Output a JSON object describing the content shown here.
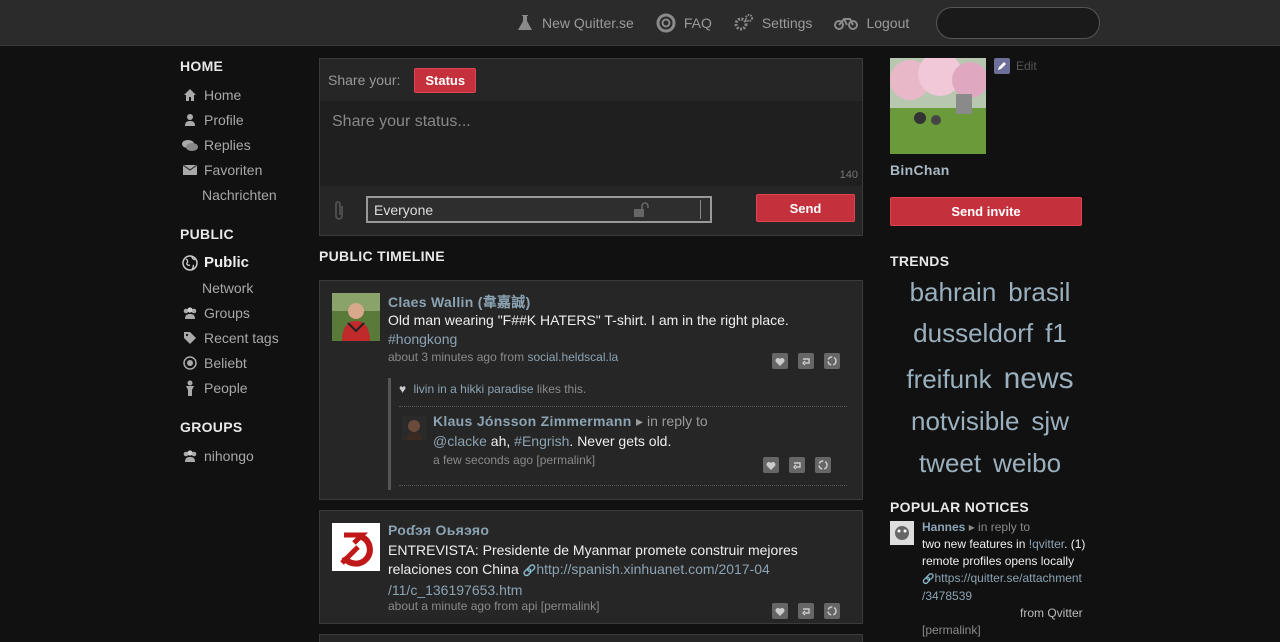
{
  "topnav": {
    "items": [
      {
        "label": "New Quitter.se",
        "icon": "flask-icon"
      },
      {
        "label": "FAQ",
        "icon": "lifebuoy-icon"
      },
      {
        "label": "Settings",
        "icon": "gears-icon"
      },
      {
        "label": "Logout",
        "icon": "bicycle-icon"
      }
    ]
  },
  "sidebar": {
    "home_heading": "HOME",
    "home_items": [
      {
        "label": "Home",
        "icon": "house-icon"
      },
      {
        "label": "Profile",
        "icon": "user-icon"
      },
      {
        "label": "Replies",
        "icon": "chat-icon"
      },
      {
        "label": "Favoriten",
        "icon": "mail-icon"
      },
      {
        "label": "Nachrichten",
        "icon": ""
      }
    ],
    "public_heading": "PUBLIC",
    "public_items": [
      {
        "label": "Public",
        "icon": "globe-icon"
      },
      {
        "label": "Network",
        "icon": ""
      },
      {
        "label": "Groups",
        "icon": "group-icon"
      },
      {
        "label": "Recent tags",
        "icon": "tag-icon"
      },
      {
        "label": "Beliebt",
        "icon": "target-icon"
      },
      {
        "label": "People",
        "icon": "person-icon"
      }
    ],
    "groups_heading": "GROUPS",
    "group_items": [
      {
        "label": "nihongo",
        "icon": "group-icon"
      }
    ]
  },
  "share": {
    "label": "Share your:",
    "type_button": "Status",
    "placeholder": "Share your status...",
    "char_count": "140",
    "scope_value": "Everyone",
    "send_label": "Send"
  },
  "timeline": {
    "title": "PUBLIC TIMELINE",
    "notices": [
      {
        "author": "Claes Wallin (韋嘉誠)",
        "text": "Old man wearing \"F##K HATERS\" T-shirt. I am in the right place.",
        "hashtag": "#hongkong",
        "time": "about 3 minutes ago",
        "from_word": "from",
        "source": "social.heldscal.la",
        "likes": {
          "who": "livin in a hikki paradise",
          "suffix": "likes this."
        },
        "reply": {
          "author": "Klaus Jónsson Zimmermann",
          "in_reply": "▸ in reply to",
          "mention": "@clacke",
          "mid": " ah, ",
          "tag": "#Engrish",
          "end": ". Never gets old.",
          "time": "a few seconds ago",
          "permalink": "[permalink]"
        }
      },
      {
        "author": "Роɗэя Оьяэяо",
        "text1": "ENTREVISTA: Presidente de Myanmar promete construir mejores",
        "text2": "relaciones con China",
        "link1": "http://spanish.xinhuanet.com/2017-04",
        "link2": "/11/c_136197653.htm",
        "time": "about a minute ago",
        "from_word": "from",
        "source": "api",
        "permalink": "[permalink]"
      }
    ]
  },
  "profile": {
    "edit": "Edit",
    "name": "BinChan",
    "invite": "Send invite"
  },
  "trends": {
    "heading": "TRENDS",
    "tags": [
      "bahrain",
      "brasil",
      "dusseldorf",
      "f1",
      "freifunk",
      "news",
      "notvisible",
      "sjw",
      "tweet",
      "weibo"
    ]
  },
  "popular": {
    "heading": "POPULAR NOTICES",
    "author": "Hannes",
    "in_reply": "▸ in reply to",
    "line1": "two new features in ",
    "group": "!qvitter",
    "line1b": ". (1)",
    "line2": "remote profiles opens locally",
    "link1": "https://quitter.se/attachment",
    "link2": "/3478539",
    "from": "from Qvitter",
    "permalink": "[permalink]"
  },
  "colors": {
    "accent": "#c4303c",
    "link": "#8ba3b3"
  }
}
